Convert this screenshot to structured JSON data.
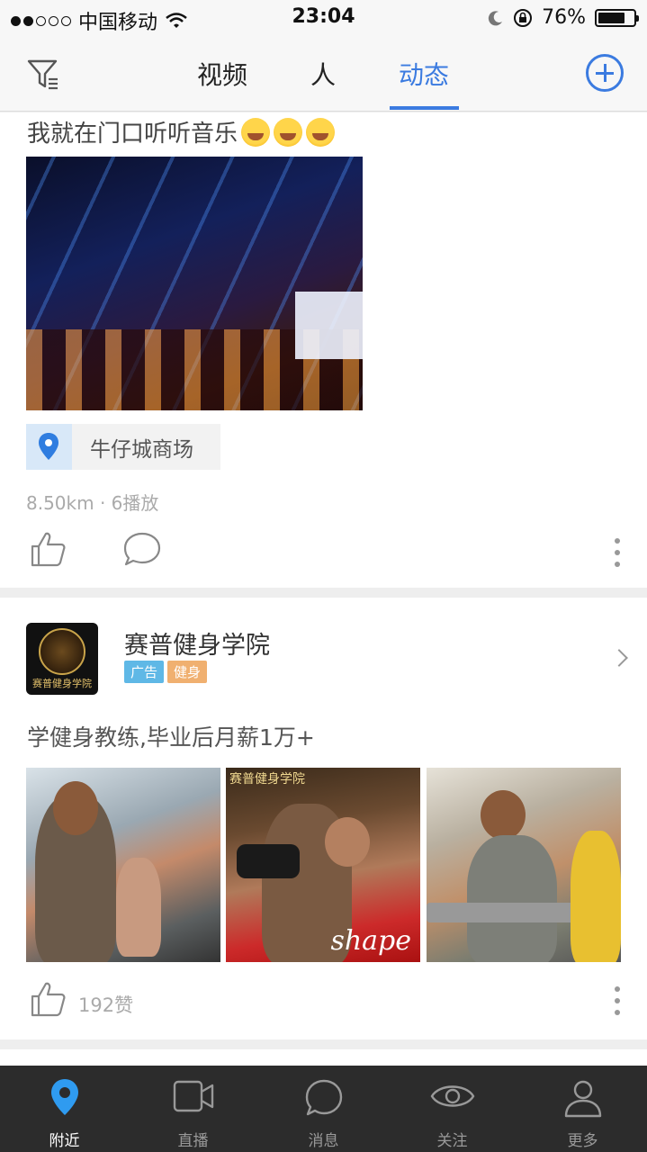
{
  "status_bar": {
    "carrier": "中国移动",
    "time": "23:04",
    "battery": "76%",
    "battery_level": 0.76,
    "signal_filled": 2,
    "signal_total": 5
  },
  "nav": {
    "tabs": [
      {
        "label": "视频",
        "active": false
      },
      {
        "label": "人",
        "active": false
      },
      {
        "label": "动态",
        "active": true
      }
    ],
    "accent_color": "#3b7be0",
    "filter_icon": "filter-icon",
    "add_icon": "plus-circle-icon"
  },
  "post": {
    "text": "我就在门口听听音乐",
    "emoji_count": 3,
    "emoji_icon": "laugh-cry-emoji",
    "location": "牛仔城商场",
    "distance_views": "8.50km · 6播放"
  },
  "ad": {
    "name": "赛普健身学院",
    "avatar_text": "赛普健身学院",
    "badges": [
      {
        "label": "广告",
        "color": "#5fb8e6"
      },
      {
        "label": "健身",
        "color": "#f0b070"
      }
    ],
    "text": "学健身教练,毕业后月薪1万+",
    "photo2_logo": "赛普健身学院",
    "photo2_shirt": "shape",
    "likes": "192赞"
  },
  "tabbar": {
    "items": [
      {
        "label": "附近",
        "icon": "location-pin-icon",
        "active": true
      },
      {
        "label": "直播",
        "icon": "video-camera-icon",
        "active": false
      },
      {
        "label": "消息",
        "icon": "chat-bubble-icon",
        "active": false
      },
      {
        "label": "关注",
        "icon": "eye-icon",
        "active": false
      },
      {
        "label": "更多",
        "icon": "user-icon",
        "active": false
      }
    ],
    "active_color": "#2f9bf0"
  }
}
